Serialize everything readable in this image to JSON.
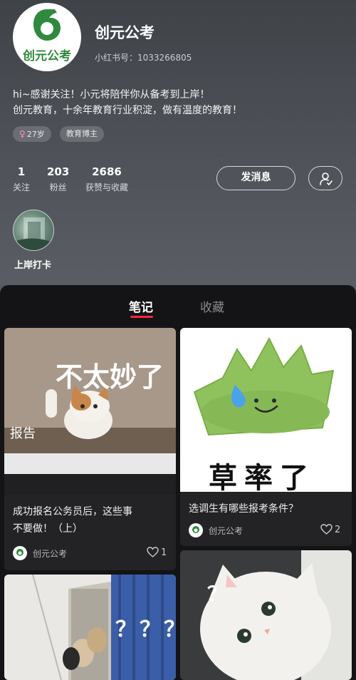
{
  "profile": {
    "logo_text": "创元公考",
    "name": "创元公考",
    "xhs_id": "小红书号：1033266805",
    "bio_lines": [
      "hi~感谢关注！小元将陪伴你从备考到上岸！",
      "创元教育，十余年教育行业积淀，做有温度的教育！"
    ],
    "tags": {
      "age": "27岁",
      "age_icon": "female-icon",
      "job": "教育博主"
    },
    "stats": [
      {
        "num": "1",
        "label": "关注"
      },
      {
        "num": "203",
        "label": "粉丝"
      },
      {
        "num": "2686",
        "label": "获赞与收藏"
      }
    ],
    "message_button": "发消息",
    "follow_icon": "user-check-icon",
    "collection_label": "上岸打卡"
  },
  "tabs": [
    "笔记",
    "收藏"
  ],
  "notes": [
    {
      "title_lines": [
        "成功报名公务员后，这些事",
        "不要做！（上）"
      ],
      "meme_text": "不太妙了",
      "overlay_text": "报告",
      "author": "创元公考",
      "likes": "1"
    },
    {
      "title_lines": [
        "选调生有哪些报考条件？"
      ],
      "meme_text": "草率了",
      "author": "创元公考",
      "likes": "2"
    },
    {
      "meme_text": "？？？"
    },
    {
      "meme_text": "？"
    }
  ],
  "colors": {
    "accent": "#ff2442",
    "brand_green": "#2f8a3e"
  }
}
